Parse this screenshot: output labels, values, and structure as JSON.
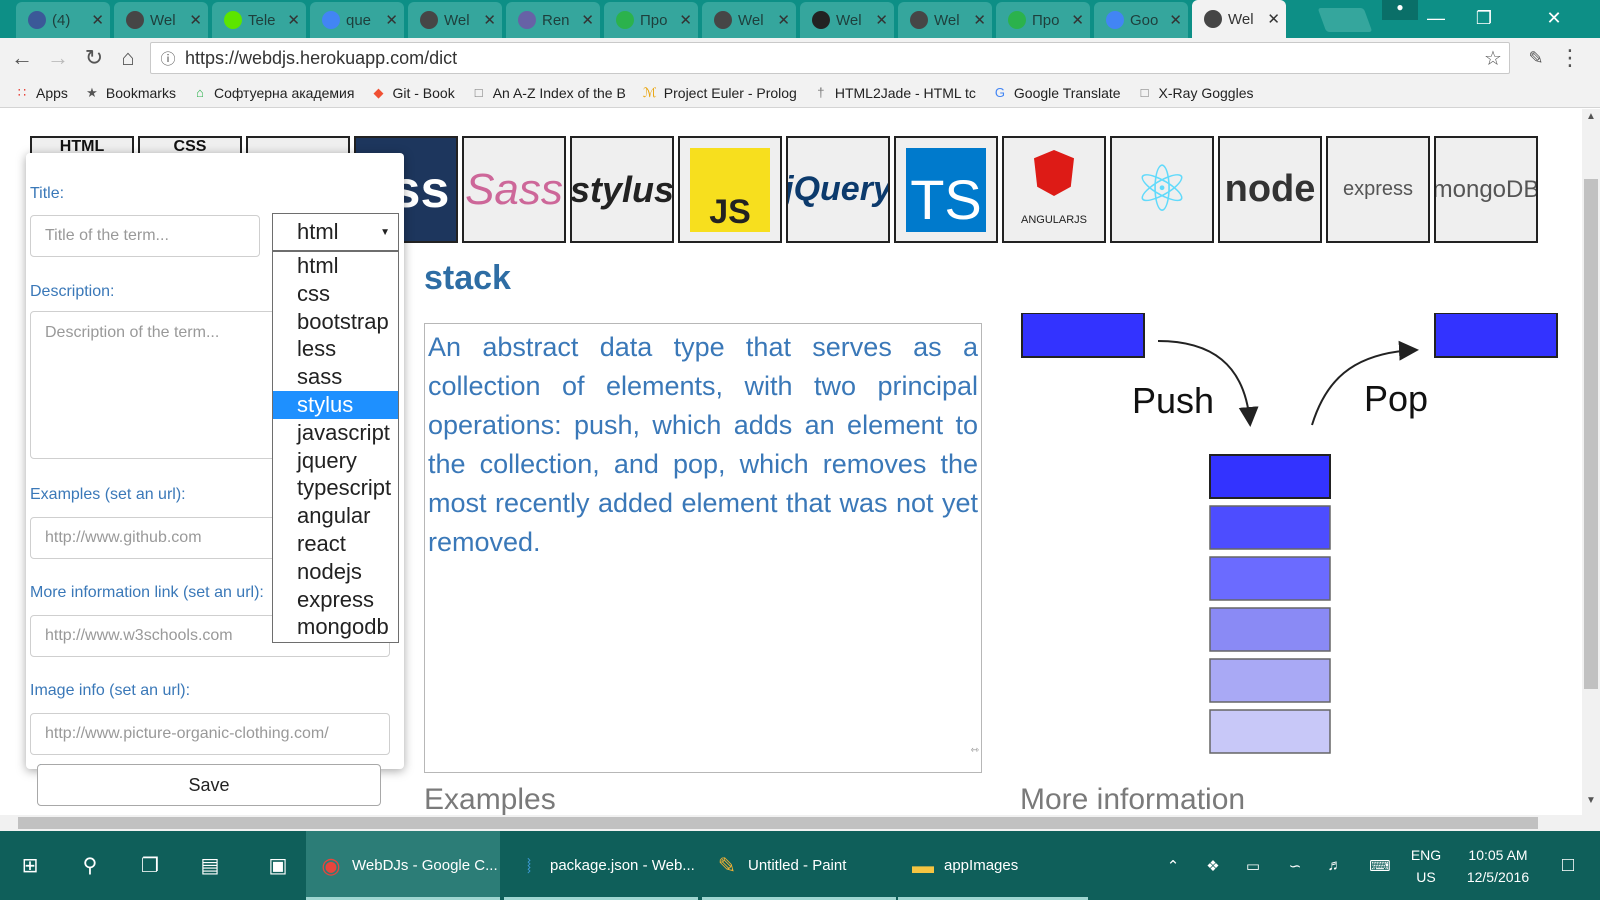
{
  "browser": {
    "tabs": [
      {
        "label": "(4) ",
        "favicon": "facebook-icon",
        "color": "#3b5998"
      },
      {
        "label": "Wel",
        "favicon": "wordpress-icon",
        "color": "#464646"
      },
      {
        "label": "Tele",
        "favicon": "telerik-icon",
        "color": "#5ce500"
      },
      {
        "label": "que",
        "favicon": "google-icon",
        "color": "#4285f4"
      },
      {
        "label": "Wel",
        "favicon": "wordpress-icon",
        "color": "#464646"
      },
      {
        "label": "Ren",
        "favicon": "heroku-icon",
        "color": "#6762a6"
      },
      {
        "label": "Про",
        "favicon": "academy-icon",
        "color": "#2bb24c"
      },
      {
        "label": "Wel",
        "favicon": "wordpress-icon",
        "color": "#464646"
      },
      {
        "label": "Wel",
        "favicon": "github-icon",
        "color": "#222222"
      },
      {
        "label": "Wel",
        "favicon": "wordpress-icon",
        "color": "#464646"
      },
      {
        "label": "Про",
        "favicon": "academy-icon",
        "color": "#2bb24c"
      },
      {
        "label": "Goo",
        "favicon": "google-translate-icon",
        "color": "#4285f4"
      },
      {
        "label": "Wel",
        "favicon": "wordpress-icon",
        "color": "#464646",
        "active": true
      }
    ],
    "url": "https://webdjs.herokuapp.com/dict",
    "bookmarks": [
      {
        "label": "Apps",
        "icon": "apps-grid-icon"
      },
      {
        "label": "Bookmarks",
        "icon": "star-icon"
      },
      {
        "label": "Софтуерна академия",
        "icon": "academy-icon"
      },
      {
        "label": "Git - Book",
        "icon": "git-icon"
      },
      {
        "label": "An A-Z Index of the B",
        "icon": "page-icon"
      },
      {
        "label": "Project Euler - Prolog",
        "icon": "euler-icon"
      },
      {
        "label": "HTML2Jade - HTML tc",
        "icon": "jade-icon"
      },
      {
        "label": "Google Translate",
        "icon": "google-translate-icon"
      },
      {
        "label": "X-Ray Goggles",
        "icon": "page-icon"
      }
    ]
  },
  "tech_icons": [
    {
      "name": "html",
      "label": "HTML"
    },
    {
      "name": "css",
      "label": "CSS"
    },
    {
      "name": "bootstrap",
      "label": ""
    },
    {
      "name": "less",
      "label": "ess"
    },
    {
      "name": "sass",
      "label": "Sass"
    },
    {
      "name": "stylus",
      "label": "stylus"
    },
    {
      "name": "javascript",
      "label": "JS"
    },
    {
      "name": "jquery",
      "label": "jQuery"
    },
    {
      "name": "typescript",
      "label": "TS"
    },
    {
      "name": "angular",
      "label": "ANGULARJS"
    },
    {
      "name": "react",
      "label": ""
    },
    {
      "name": "nodejs",
      "label": "node"
    },
    {
      "name": "express",
      "label": "express"
    },
    {
      "name": "mongodb",
      "label": "mongoDB"
    }
  ],
  "term": {
    "title": "stack",
    "description": "An abstract data type that serves as a collection of elements, with two principal operations: push, which adds an element to the collection, and pop, which removes the most recently added element that was not yet removed."
  },
  "sections": {
    "examples": "Examples",
    "more_info": "More information"
  },
  "diagram": {
    "push_label": "Push",
    "pop_label": "Pop",
    "colors": [
      "#3333ff",
      "#4d4dff",
      "#6b6bff",
      "#8a8af5",
      "#a9a9f5",
      "#c8c8f8"
    ]
  },
  "form": {
    "title_label": "Title:",
    "title_placeholder": "Title of the term...",
    "description_label": "Description:",
    "description_placeholder": "Description of the term...",
    "examples_label": "Examples (set an url):",
    "examples_placeholder": "http://www.github.com",
    "more_info_label": "More information link (set an url):",
    "more_info_placeholder": "http://www.w3schools.com",
    "image_label": "Image info (set an url):",
    "image_placeholder": "http://www.picture-organic-clothing.com/",
    "save_label": "Save",
    "category_selected": "html",
    "category_options": [
      "html",
      "css",
      "bootstrap",
      "less",
      "sass",
      "stylus",
      "javascript",
      "jquery",
      "typescript",
      "angular",
      "react",
      "nodejs",
      "express",
      "mongodb"
    ],
    "category_highlighted": "stylus"
  },
  "taskbar": {
    "apps": [
      {
        "label": "WebDJs - Google C...",
        "icon": "chrome-icon",
        "active": true
      },
      {
        "label": "package.json - Web...",
        "icon": "vscode-icon"
      },
      {
        "label": "Untitled - Paint",
        "icon": "paint-icon"
      },
      {
        "label": "appImages",
        "icon": "folder-icon"
      }
    ],
    "lang_top": "ENG",
    "lang_bottom": "US",
    "time": "10:05 AM",
    "date": "12/5/2016"
  }
}
